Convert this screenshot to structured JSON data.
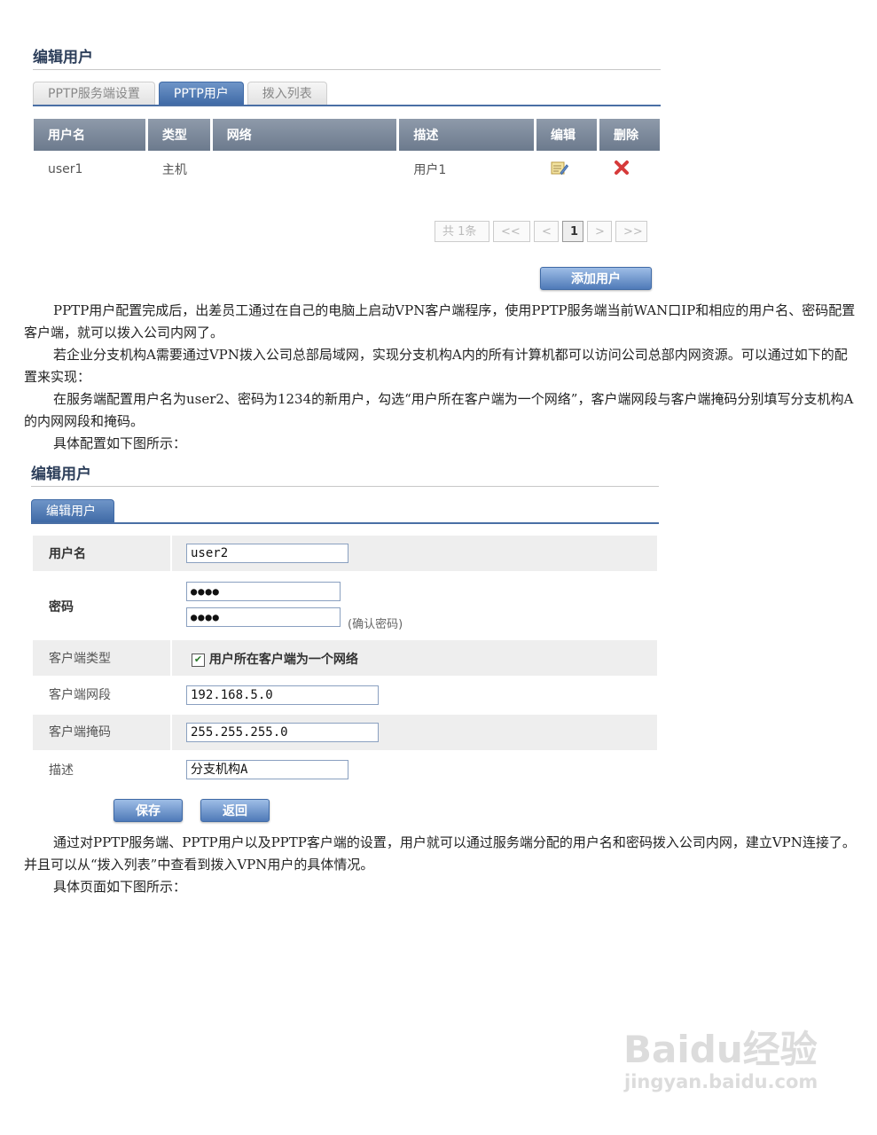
{
  "top": {
    "title": "编辑用户",
    "tabs": [
      "PPTP服务端设置",
      "PPTP用户",
      "拨入列表"
    ],
    "table": {
      "headers": [
        "用户名",
        "类型",
        "网络",
        "描述",
        "编辑",
        "删除"
      ],
      "rows": [
        {
          "username": "user1",
          "type": "主机",
          "network": "",
          "desc": "用户1"
        }
      ]
    },
    "pager": {
      "total": "共 1条",
      "first": "<<",
      "prev": "<",
      "current": "1",
      "next": ">",
      "last": ">>"
    },
    "add_button": "添加用户"
  },
  "paragraphs1": [
    "PPTP用户配置完成后，出差员工通过在自己的电脑上启动VPN客户端程序，使用PPTP服务端当前WAN口IP和相应的用户名、密码配置客户端，就可以拨入公司内网了。",
    "若企业分支机构A需要通过VPN拨入公司总部局域网，实现分支机构A内的所有计算机都可以访问公司总部内网资源。可以通过如下的配置来实现：",
    "在服务端配置用户名为user2、密码为1234的新用户，勾选“用户所在客户端为一个网络”，客户端网段与客户端掩码分别填写分支机构A的内网网段和掩码。",
    "具体配置如下图所示："
  ],
  "form": {
    "title": "编辑用户",
    "tab": "编辑用户",
    "username_label": "用户名",
    "username_value": "user2",
    "password_label": "密码",
    "password_value": "●●●●",
    "confirm_value": "●●●●",
    "confirm_hint": "(确认密码)",
    "client_type_label": "客户端类型",
    "client_type_checkbox": "用户所在客户端为一个网络",
    "client_type_checked": true,
    "client_net_label": "客户端网段",
    "client_net_value": "192.168.5.0",
    "client_mask_label": "客户端掩码",
    "client_mask_value": "255.255.255.0",
    "desc_label": "描述",
    "desc_value": "分支机构A",
    "save_button": "保存",
    "back_button": "返回"
  },
  "paragraphs2": [
    "通过对PPTP服务端、PPTP用户以及PPTP客户端的设置，用户就可以通过服务端分配的用户名和密码拨入公司内网，建立VPN连接了。并且可以从“拨入列表”中查看到拨入VPN用户的具体情况。",
    "具体页面如下图所示："
  ],
  "watermark": {
    "brand": "Baidu经验",
    "url": "jingyan.baidu.com"
  },
  "colors": {
    "accent": "#4a6fa5",
    "header_bg": "#7a8799",
    "delete": "#d63a3a"
  }
}
